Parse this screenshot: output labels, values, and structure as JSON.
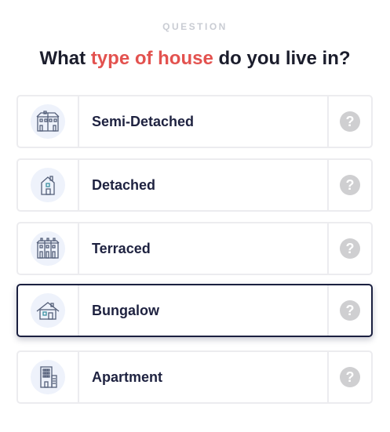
{
  "question": {
    "eyebrow": "QUESTION",
    "title_pre": "What ",
    "title_highlight": "type of house",
    "title_post": " do you live in?"
  },
  "options": [
    {
      "label": "Semi-Detached",
      "icon": "semi-detached-house-icon",
      "help": "?",
      "selected": false
    },
    {
      "label": "Detached",
      "icon": "detached-house-icon",
      "help": "?",
      "selected": false
    },
    {
      "label": "Terraced",
      "icon": "terraced-house-icon",
      "help": "?",
      "selected": false
    },
    {
      "label": "Bungalow",
      "icon": "bungalow-icon",
      "help": "?",
      "selected": true
    },
    {
      "label": "Apartment",
      "icon": "apartment-icon",
      "help": "?",
      "selected": false
    }
  ],
  "colors": {
    "accent": "#e3524f",
    "text": "#1e2240",
    "selected_border": "#1b2040",
    "icon_bg": "#eef2fb"
  }
}
